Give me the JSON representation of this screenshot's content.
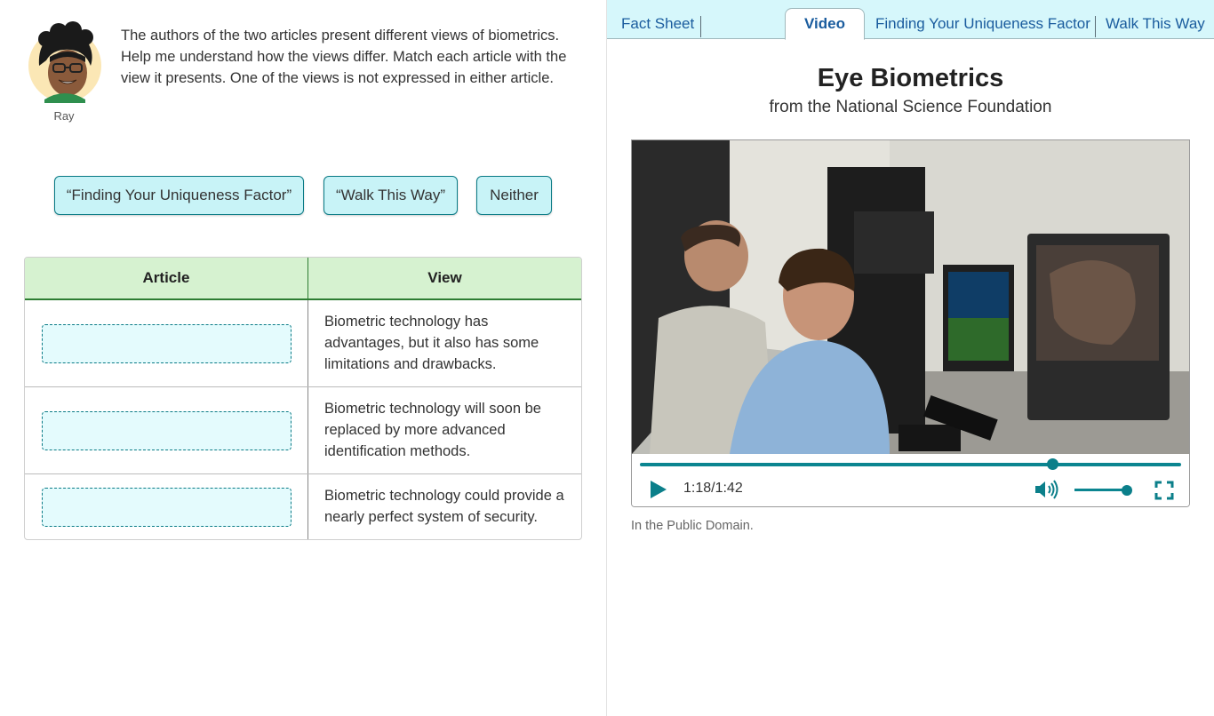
{
  "character": {
    "name": "Ray"
  },
  "prompt": "The authors of the two articles present different views of biometrics. Help me understand how the views differ. Match each article with the view it presents. One of the views is not expressed in either article.",
  "chips": [
    "“Finding Your Uniqueness Factor”",
    "“Walk This Way”",
    "Neither"
  ],
  "table": {
    "headers": [
      "Article",
      "View"
    ],
    "rows": [
      {
        "view": "Biometric technology has advantages, but it also has some limitations and drawbacks."
      },
      {
        "view": "Biometric technology will soon be replaced by more advanced identification methods."
      },
      {
        "view": "Biometric technology could provide a nearly perfect system of security."
      }
    ]
  },
  "tabs": [
    "Fact Sheet",
    "Video",
    "Finding Your Uniqueness Factor",
    "Walk This Way"
  ],
  "active_tab": "Video",
  "video": {
    "title": "Eye Biometrics",
    "subtitle": "from the National Science Foundation",
    "time": "1:18/1:42",
    "progress_fraction": 0.762,
    "volume_fraction": 0.9,
    "credit": "In the Public Domain."
  },
  "colors": {
    "accent": "#0b8590",
    "chip_bg": "#c8f3f7",
    "tab_bg": "#d6f7fb",
    "table_header_bg": "#d6f2d0",
    "link": "#1a5c9e"
  }
}
